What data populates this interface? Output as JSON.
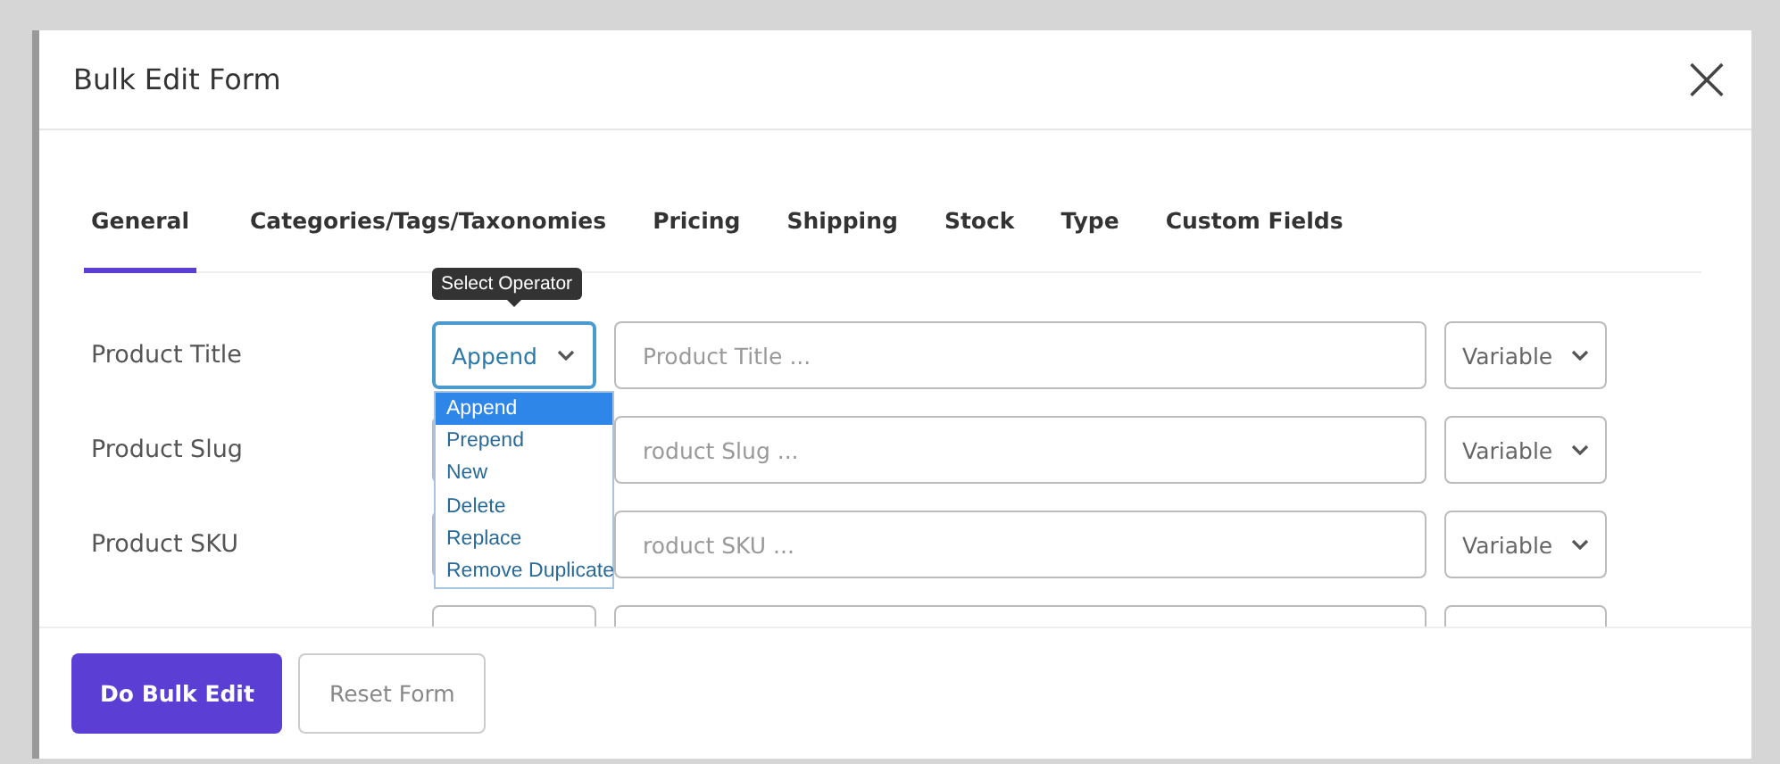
{
  "modal": {
    "title": "Bulk Edit Form",
    "close": "×"
  },
  "tabs": [
    {
      "label": "General",
      "selected": true
    },
    {
      "label": "Categories/Tags/Taxonomies",
      "selected": false
    },
    {
      "label": "Pricing",
      "selected": false
    },
    {
      "label": "Shipping",
      "selected": false
    },
    {
      "label": "Stock",
      "selected": false
    },
    {
      "label": "Type",
      "selected": false
    },
    {
      "label": "Custom Fields",
      "selected": false
    }
  ],
  "tooltip": "Select Operator",
  "rows": [
    {
      "label": "Product Title",
      "operator": "Append",
      "placeholder": "Product Title ...",
      "type": "Variable"
    },
    {
      "label": "Product Slug",
      "placeholder": "roduct Slug ...",
      "type": "Variable"
    },
    {
      "label": "Product SKU",
      "placeholder": "roduct SKU ...",
      "type": "Variable"
    }
  ],
  "operator_menu": [
    {
      "label": "Append",
      "selected": true
    },
    {
      "label": "Prepend",
      "selected": false
    },
    {
      "label": "New",
      "selected": false
    },
    {
      "label": "Delete",
      "selected": false
    },
    {
      "label": "Replace",
      "selected": false
    },
    {
      "label": "Remove Duplicate",
      "selected": false
    }
  ],
  "buttons": [
    {
      "label": "Do Bulk Edit",
      "kind": "primary"
    },
    {
      "label": "Reset Form",
      "kind": "secondary"
    }
  ]
}
